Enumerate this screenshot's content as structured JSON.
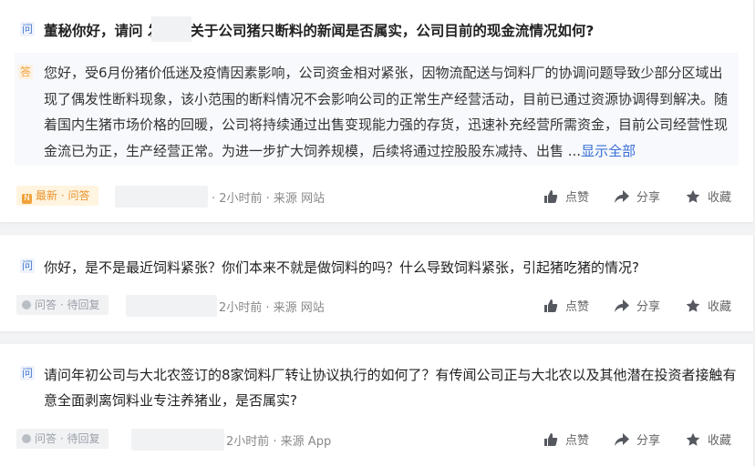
{
  "posts": [
    {
      "q_icon": "问",
      "question": "董秘你好，请问          发布的关于公司猪只断料的新闻是否属实，公司目前的现金流情况如何?",
      "a_icon": "答",
      "answer": "您好，受6月份猪价低迷及疫情因素影响，公司资金相对紧张，因物流配送与饲料厂的协调问题导致少部分区域出现了偶发性断料现象，该小范围的断料情况不会影响公司的正常生产经营活动，目前已通过资源协调得到解决。随着国内生猪市场价格的回暖，公司将持续通过出售变现能力强的存货，迅速补充经营所需资金，目前公司经营性现金流已为正，生产经营正常。为进一步扩大饲养规模，后续将通过控股股东减持、出售 ...",
      "show_all": "显示全部",
      "badge": "最新 · 问答",
      "time_source": "· 2小时前 · 来源 网站"
    },
    {
      "q_icon": "问",
      "question": "你好，是不是最近饲料紧张？你们本来不就是做饲料的吗？什么导致饲料紧张，引起猪吃猪的情况?",
      "badge": "问答 · 待回复",
      "time_source": "2小时前 · 来源 网站"
    },
    {
      "q_icon": "问",
      "question": "请问年初公司与大北农签订的8家饲料厂转让协议执行的如何了？有传闻公司正与大北农以及其他潜在投资者接触有意全面剥离饲料业专注养猪业，是否属实?",
      "badge": "问答 · 待回复",
      "time_source": "2小时前 · 来源 App"
    }
  ],
  "actions": {
    "like": "点赞",
    "share": "分享",
    "favorite": "收藏"
  },
  "colors": {
    "accent": "#3a6fd8",
    "badge_new_bg": "#fff4e0",
    "badge_new_text": "#e8922b",
    "answer_bg": "#f7f9fc"
  },
  "icons": {
    "like": "thumbs-up-icon",
    "share": "share-arrow-icon",
    "favorite": "star-icon"
  }
}
